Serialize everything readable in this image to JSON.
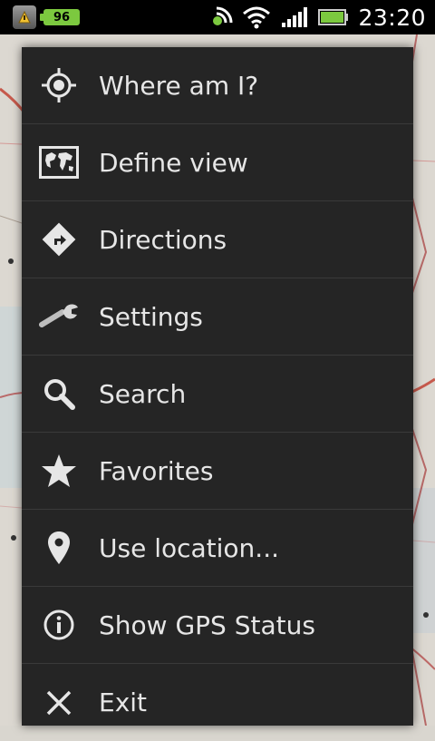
{
  "status_bar": {
    "battery_badge": "96",
    "time": "23:20",
    "icons": [
      "app-notification-icon",
      "battery-level-icon",
      "nfc-icon",
      "wifi-icon",
      "signal-icon",
      "battery-icon"
    ]
  },
  "menu": {
    "items": [
      {
        "label": "Where am I?",
        "icon": "crosshair-icon"
      },
      {
        "label": "Define view",
        "icon": "world-map-icon"
      },
      {
        "label": "Directions",
        "icon": "directions-icon"
      },
      {
        "label": "Settings",
        "icon": "wrench-icon"
      },
      {
        "label": "Search",
        "icon": "search-icon"
      },
      {
        "label": "Favorites",
        "icon": "star-icon"
      },
      {
        "label": "Use location...",
        "icon": "location-pin-icon"
      },
      {
        "label": "Show GPS Status",
        "icon": "info-icon"
      },
      {
        "label": "Exit",
        "icon": "close-icon"
      }
    ]
  },
  "colors": {
    "menu_bg": "#252525",
    "menu_text": "#e6e6e6",
    "divider": "#3a3a3a",
    "status_bg": "#000000",
    "battery_green": "#7cc93f"
  }
}
